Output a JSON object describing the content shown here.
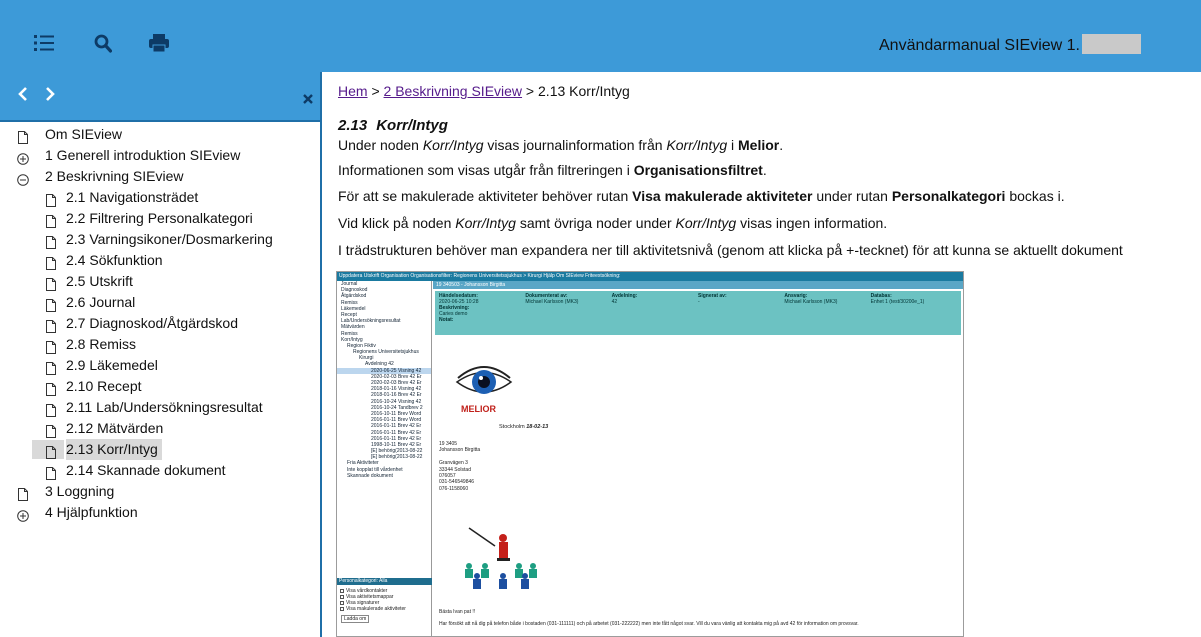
{
  "topbar": {
    "icons": [
      "list-icon",
      "search-icon",
      "print-icon"
    ],
    "title": "Användarmanual SIEview 1."
  },
  "sidebar": {
    "nav": {
      "back_icon": "chevron-left-icon",
      "forward_icon": "chevron-right-icon",
      "close_icon": "close-icon"
    },
    "items": [
      {
        "label": "Om SIEview",
        "level": 1,
        "icon": "page-icon"
      },
      {
        "label": "1 Generell introduktion SIEview",
        "level": 1,
        "icon": "plus-circle-icon"
      },
      {
        "label": "2 Beskrivning SIEview",
        "level": 1,
        "icon": "minus-circle-icon"
      },
      {
        "label": "2.1 Navigationsträdet",
        "level": 2,
        "icon": "page-icon"
      },
      {
        "label": "2.2 Filtrering Personalkategori",
        "level": 2,
        "icon": "page-icon"
      },
      {
        "label": "2.3 Varningsikoner/Dosmarkering",
        "level": 2,
        "icon": "page-icon"
      },
      {
        "label": "2.4 Sökfunktion",
        "level": 2,
        "icon": "page-icon"
      },
      {
        "label": "2.5 Utskrift",
        "level": 2,
        "icon": "page-icon"
      },
      {
        "label": "2.6 Journal",
        "level": 2,
        "icon": "page-icon"
      },
      {
        "label": "2.7 Diagnoskod/Åtgärdskod",
        "level": 2,
        "icon": "page-icon"
      },
      {
        "label": "2.8 Remiss",
        "level": 2,
        "icon": "page-icon"
      },
      {
        "label": "2.9 Läkemedel",
        "level": 2,
        "icon": "page-icon"
      },
      {
        "label": "2.10 Recept",
        "level": 2,
        "icon": "page-icon"
      },
      {
        "label": "2.11 Lab/Undersökningsresultat",
        "level": 2,
        "icon": "page-icon"
      },
      {
        "label": "2.12 Mätvärden",
        "level": 2,
        "icon": "page-icon"
      },
      {
        "label": "2.13 Korr/Intyg",
        "level": 2,
        "icon": "page-icon",
        "selected": true
      },
      {
        "label": "2.14 Skannade dokument",
        "level": 2,
        "icon": "page-icon"
      },
      {
        "label": "3 Loggning",
        "level": 1,
        "icon": "page-icon"
      },
      {
        "label": "4 Hjälpfunktion",
        "level": 1,
        "icon": "plus-circle-icon"
      }
    ]
  },
  "content": {
    "breadcrumb": {
      "home": "Hem",
      "sep1": " > ",
      "parent": "2 Beskrivning SIEview",
      "sep2": " > ",
      "current": "2.13 Korr/Intyg"
    },
    "heading": {
      "number": "2.13",
      "title": "Korr/Intyg"
    },
    "paragraphs": {
      "p1": {
        "a": "Under noden ",
        "b": "Korr/Intyg",
        "c": " visas journalinformation från ",
        "d": "Korr/Intyg",
        "e": " i ",
        "f": "Melior",
        "g": "."
      },
      "p2": {
        "a": "Informationen som visas utgår från filtreringen i ",
        "b": "Organisationsfiltret",
        "c": "."
      },
      "p3": {
        "a": "För att se makulerade aktiviteter behöver rutan ",
        "b": "Visa makulerade aktiviteter",
        "c": " under rutan ",
        "d": "Personalkategori",
        "e": " bockas i."
      },
      "p4": {
        "a": "Vid klick på noden ",
        "b": "Korr/Intyg",
        "c": " samt övriga noder under ",
        "d": "Korr/Intyg",
        "e": " visas ingen information."
      },
      "p5": "I trädstrukturen behöver man expandera ner till aktivitetsnivå (genom att klicka på +-tecknet) för att kunna se aktuellt dokument"
    },
    "screenshot": {
      "toolbar": "Uppdatera  Utskrift  Organisation  Organisationsfilter: Regionens Universitetssjukhus > Kirurgi  Hjälp  Om SIEview  Friteextsökning:",
      "patient": "19 340503 -        Johansson Birgitta",
      "tree": [
        "Journal",
        "Diagnoskod",
        "Åtgärdskod",
        "Remiss",
        "Läkemedel",
        "Recept",
        "Lab/Undersökningsresultat",
        "Mätvärden",
        "Remiss",
        "Korr/Intyg",
        "Region Fiktiv",
        "Regionens Universitetsjukhus",
        "Kirurgi",
        "Avdelning 42",
        "2020-06-25 Visning 42",
        "2020-02-03 Brev 42 Er",
        "2020-02-03 Brev 42 Er",
        "2018-01-16 Visning 42",
        "2018-01-16 Brev 42 Er",
        "2016-10-24 Visning 42",
        "2016-10-24 Tandbrev 2",
        "2016-10-11 Brev Word",
        "2016-01-11 Brev Word",
        "2016-01-11 Brev 42 Er",
        "2016-01-11 Brev 42 Er",
        "2016-01-11 Brev 42 Er",
        "1998-10-11 Brev 42 Er",
        "[E] behörig(2013-08-22",
        "[E] behörig(2013-08-22",
        "Fria Aktiviteter",
        "Inte kopplat till vårdenhet",
        "Skannade dokument"
      ],
      "personalkategori": "Personalkategori: Alla",
      "checkboxes": [
        "Visa vårdkontakter",
        "Visa aktivitetsmappar",
        "Visa signaturer",
        "Visa makulerade aktiviteter"
      ],
      "leddo": "Ladda om",
      "meta_headers": [
        "Händelsedatum:",
        "Dokumenterat av:",
        "Avdelning:",
        "Signerat av:",
        "Ansvarig:",
        "Databas:"
      ],
      "meta_values": [
        "2020-06-25 10:28",
        "Michael Karlsson (MK3)",
        "42",
        "-",
        "Michael Karlsson (MK3)",
        "Enhet 1 (test/30200e_1)"
      ],
      "meta_extra": [
        "Beskrivning:",
        "Caries demo",
        "Notat:"
      ],
      "melior": "MELIOR",
      "city": "Stockholm",
      "date": "18-02-13",
      "address": [
        "19 3405",
        "Johansson Birgitta",
        "",
        "Granvägen 3",
        "33344 Solstad",
        "076057",
        "031-546549846",
        "076-1158060"
      ],
      "greeting": "Bästa Ivan pat !!",
      "body": "Har försökt att nå dig på telefon både i bostaden (031-111111) och på arbetet (031-222222) men inte fått något svar. Vill du vara vänlig att kontakta mig på avd 42 för information om provsvar."
    }
  }
}
